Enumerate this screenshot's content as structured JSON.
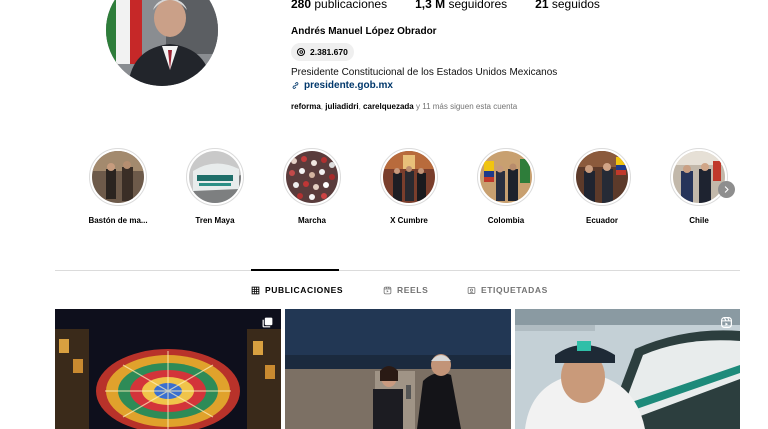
{
  "profile": {
    "stats": {
      "posts_count": "280",
      "posts_label": "publicaciones",
      "followers_count": "1,3 M",
      "followers_label": "seguidores",
      "following_count": "21",
      "following_label": "seguidos"
    },
    "name": "Andrés Manuel López Obrador",
    "threads_count": "2.381.670",
    "bio": "Presidente Constitucional de los Estados Unidos Mexicanos",
    "link": "presidente.gob.mx",
    "followed_by": {
      "names": [
        "reforma",
        "juliadidri",
        "carelquezada"
      ],
      "suffix": "y 11 más siguen esta cuenta"
    }
  },
  "highlights": [
    {
      "label": "Bastón de ma..."
    },
    {
      "label": "Tren Maya"
    },
    {
      "label": "Marcha"
    },
    {
      "label": "X Cumbre"
    },
    {
      "label": "Colombia"
    },
    {
      "label": "Ecuador"
    },
    {
      "label": "Chile"
    }
  ],
  "tabs": [
    {
      "label": "PUBLICACIONES",
      "icon": "grid-icon",
      "active": true
    },
    {
      "label": "REELS",
      "icon": "reels-icon",
      "active": false
    },
    {
      "label": "ETIQUETADAS",
      "icon": "tagged-icon",
      "active": false
    }
  ],
  "posts": [
    {
      "type": "carousel",
      "icon": "carousel-icon"
    },
    {
      "type": "image"
    },
    {
      "type": "reel",
      "icon": "reel-icon"
    }
  ],
  "colors": {
    "link": "#00376b",
    "muted": "#737373",
    "divider": "#dbdbdb"
  }
}
